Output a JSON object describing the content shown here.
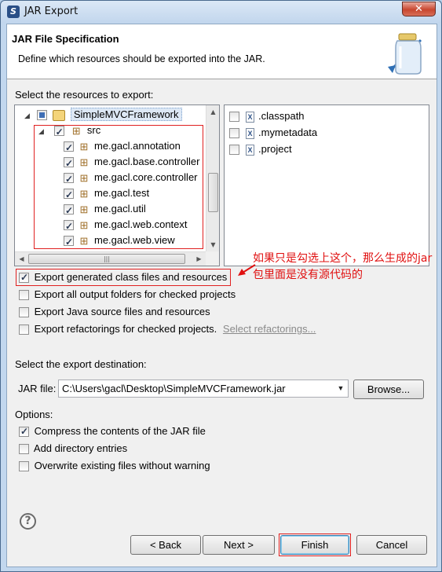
{
  "window": {
    "title": "JAR Export",
    "close_glyph": "✕"
  },
  "header": {
    "title": "JAR File Specification",
    "description": "Define which resources should be exported into the JAR."
  },
  "resources_label": "Select the resources to export:",
  "tree": {
    "project": "SimpleMVCFramework",
    "folder": "src",
    "packages": [
      "me.gacl.annotation",
      "me.gacl.base.controller",
      "me.gacl.core.controller",
      "me.gacl.test",
      "me.gacl.util",
      "me.gacl.web.context",
      "me.gacl.web.view"
    ]
  },
  "files": [
    {
      "name": ".classpath",
      "checked": false
    },
    {
      "name": ".mymetadata",
      "checked": false
    },
    {
      "name": ".project",
      "checked": false
    }
  ],
  "export_options": [
    {
      "label": "Export generated class files and resources",
      "checked": true
    },
    {
      "label": "Export all output folders for checked projects",
      "checked": false
    },
    {
      "label": "Export Java source files and resources",
      "checked": false
    },
    {
      "label": "Export refactorings for checked projects.",
      "checked": false
    }
  ],
  "select_refactorings_link": "Select refactorings...",
  "annotation": "如果只是勾选上这个，那么生成的jar包里面是没有源代码的",
  "destination": {
    "section_label": "Select the export destination:",
    "field_label": "JAR file:",
    "value": "C:\\Users\\gacl\\Desktop\\SimpleMVCFramework.jar",
    "browse": "Browse..."
  },
  "options": {
    "label": "Options:",
    "items": [
      {
        "label": "Compress the contents of the JAR file",
        "checked": true
      },
      {
        "label": "Add directory entries",
        "checked": false
      },
      {
        "label": "Overwrite existing files without warning",
        "checked": false
      }
    ]
  },
  "buttons": {
    "help": "?",
    "back": "< Back",
    "next": "Next >",
    "finish": "Finish",
    "cancel": "Cancel"
  },
  "colors": {
    "annotation_red": "#e01010",
    "link_gray": "#8a8a8a"
  }
}
